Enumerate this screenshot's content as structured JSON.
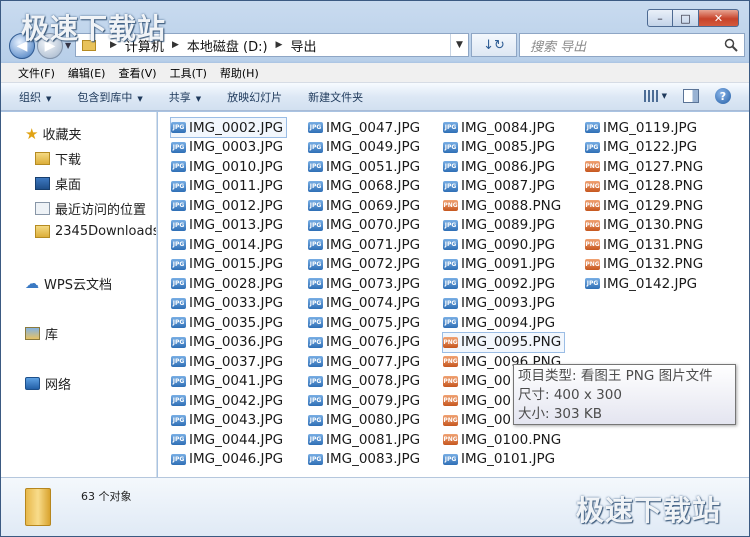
{
  "window": {
    "caption": {
      "minimize": "–",
      "maximize": "□",
      "close": "✕"
    }
  },
  "nav": {
    "back": "◀",
    "forward": "▶",
    "breadcrumbs": [
      "计算机",
      "本地磁盘 (D:)",
      "导出"
    ],
    "refresh": "↓↻",
    "search_placeholder": "搜索 导出"
  },
  "menubar": [
    "文件(F)",
    "编辑(E)",
    "查看(V)",
    "工具(T)",
    "帮助(H)"
  ],
  "cmdbar": [
    "组织",
    "包含到库中",
    "共享",
    "放映幻灯片",
    "新建文件夹"
  ],
  "navpane": {
    "favorites_label": "收藏夹",
    "favorites": [
      "下载",
      "桌面",
      "最近访问的位置",
      "2345Downloads"
    ],
    "wps": "WPS云文档",
    "libraries": "库",
    "network": "网络"
  },
  "files": {
    "col1": [
      "IMG_0002.JPG",
      "IMG_0003.JPG",
      "IMG_0010.JPG",
      "IMG_0011.JPG",
      "IMG_0012.JPG",
      "IMG_0013.JPG",
      "IMG_0014.JPG",
      "IMG_0015.JPG",
      "IMG_0028.JPG",
      "IMG_0033.JPG",
      "IMG_0035.JPG",
      "IMG_0036.JPG",
      "IMG_0037.JPG",
      "IMG_0041.JPG",
      "IMG_0042.JPG",
      "IMG_0043.JPG",
      "IMG_0044.JPG",
      "IMG_0046.JPG"
    ],
    "col2": [
      "IMG_0047.JPG",
      "IMG_0049.JPG",
      "IMG_0051.JPG",
      "IMG_0068.JPG",
      "IMG_0069.JPG",
      "IMG_0070.JPG",
      "IMG_0071.JPG",
      "IMG_0072.JPG",
      "IMG_0073.JPG",
      "IMG_0074.JPG",
      "IMG_0075.JPG",
      "IMG_0076.JPG",
      "IMG_0077.JPG",
      "IMG_0078.JPG",
      "IMG_0079.JPG",
      "IMG_0080.JPG",
      "IMG_0081.JPG",
      "IMG_0083.JPG"
    ],
    "col3": [
      "IMG_0084.JPG",
      "IMG_0085.JPG",
      "IMG_0086.JPG",
      "IMG_0087.JPG",
      "IMG_0088.PNG",
      "IMG_0089.JPG",
      "IMG_0090.JPG",
      "IMG_0091.JPG",
      "IMG_0092.JPG",
      "IMG_0093.JPG",
      "IMG_0094.JPG",
      "IMG_0095.PNG",
      "IMG_0096.PNG",
      "IMG_00",
      "IMG_00",
      "IMG_00",
      "IMG_0100.PNG",
      "IMG_0101.JPG"
    ],
    "col4": [
      "IMG_0119.JPG",
      "IMG_0122.JPG",
      "IMG_0127.PNG",
      "IMG_0128.PNG",
      "IMG_0129.PNG",
      "IMG_0130.PNG",
      "IMG_0131.PNG",
      "IMG_0132.PNG",
      "IMG_0142.JPG"
    ]
  },
  "tooltip": {
    "type": "项目类型: 看图王 PNG 图片文件",
    "size": "尺寸: 400 x 300",
    "filesize": "大小: 303 KB"
  },
  "details": {
    "count": "63 个对象"
  },
  "watermark": "极速下载站"
}
